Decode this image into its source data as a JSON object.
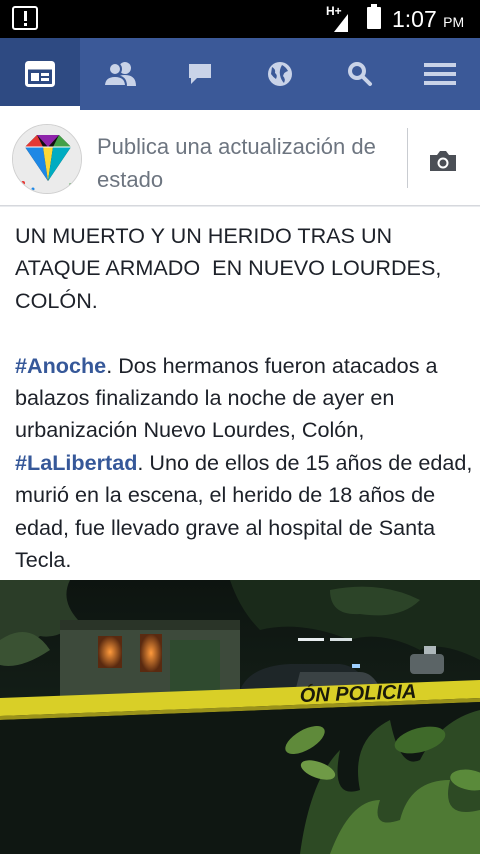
{
  "status_bar": {
    "network": "H+",
    "time": "1:07",
    "ampm": "PM"
  },
  "nav": {
    "items": [
      {
        "name": "news-feed",
        "icon": "news-feed-icon",
        "active": true
      },
      {
        "name": "friends",
        "icon": "friends-icon",
        "active": false
      },
      {
        "name": "messages",
        "icon": "chat-bubble-icon",
        "active": false
      },
      {
        "name": "notifications",
        "icon": "globe-icon",
        "active": false
      },
      {
        "name": "search",
        "icon": "search-icon",
        "active": false
      },
      {
        "name": "menu",
        "icon": "hamburger-menu-icon",
        "active": false
      }
    ]
  },
  "composer": {
    "prompt": "Publica una actualización de estado",
    "camera_icon": "camera-icon"
  },
  "post": {
    "headline": "UN MUERTO Y UN HERIDO TRAS UN ATAQUE ARMADO  EN NUEVO LOURDES, COLÓN.",
    "hashtag1": "#Anoche",
    "body1": ". Dos hermanos fueron atacados a balazos finalizando la noche de ayer en urbanización Nuevo Lourdes, Colón, ",
    "hashtag2": "#LaLibertad",
    "body2": ". Uno de ellos de 15 años de edad, murió en la escena, el herido de 18 años de edad, fue llevado grave al hospital de Santa Tecla."
  },
  "photo": {
    "tape_text": "ÓN POLICIA"
  },
  "colors": {
    "brand": "#3b5998",
    "nav_active": "#2e4a82",
    "hashtag": "#365899"
  }
}
